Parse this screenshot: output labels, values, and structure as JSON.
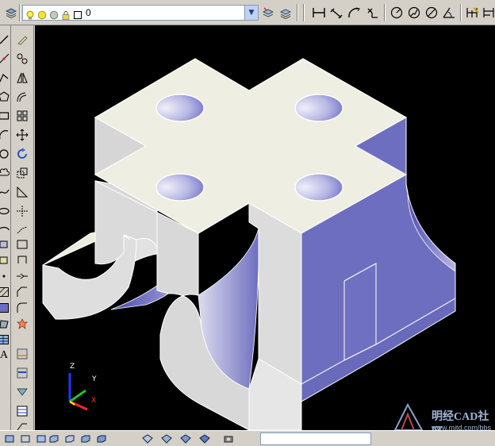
{
  "toolbar": {
    "layer_combo": {
      "current_layer": "0",
      "icons": [
        "layer-manager-icon",
        "bulb-on-icon",
        "sun-thaw-icon",
        "color-swatch-icon",
        "lock-icon",
        "square-color-icon"
      ]
    },
    "buttons": [
      "make-object-layer-current-icon",
      "layer-previous-icon",
      "linear-dimension-icon",
      "aligned-dimension-icon",
      "arc-length-icon",
      "ordinate-dimension-icon",
      "radius-dimension-icon",
      "jogged-dimension-icon",
      "diameter-dimension-icon",
      "angular-dimension-icon",
      "quick-dimension-icon",
      "baseline-dimension-icon"
    ]
  },
  "left_toolbar": {
    "draw_tools": [
      "line-icon",
      "construction-line-icon",
      "polyline-icon",
      "polygon-icon",
      "rectangle-icon",
      "arc-icon",
      "circle-icon",
      "revision-cloud-icon",
      "spline-icon",
      "ellipse-icon",
      "ellipse-arc-icon",
      "insert-block-icon",
      "make-block-icon",
      "point-icon",
      "hatch-icon",
      "gradient-icon",
      "region-icon",
      "table-icon",
      "multiline-text-icon"
    ],
    "modify_tools": [
      "erase-icon",
      "copy-icon",
      "mirror-icon",
      "offset-icon",
      "array-icon",
      "move-icon",
      "rotate-icon",
      "scale-icon",
      "stretch-icon",
      "trim-icon",
      "extend-icon",
      "break-at-point-icon",
      "break-icon",
      "join-icon",
      "chamfer-icon",
      "fillet-icon",
      "explode-icon"
    ],
    "extra_tools": [
      "dimension-style-icon",
      "dim-update-icon",
      "text-style-icon",
      "table-style-icon",
      "multileader-icon"
    ]
  },
  "viewport": {
    "ucs": {
      "z_label": "Z",
      "y_label": "Y",
      "x_label": "X"
    },
    "colors": {
      "background": "#000000",
      "top_face": "#eeeee2",
      "light_face": "#d9d9d9",
      "blue_face": "#6e6ec0",
      "hole_light": "#f0f0fa",
      "hole_dark": "#6c6cc6",
      "edge": "#ffffff"
    }
  },
  "bottom_toolbar": {
    "buttons": [
      "top-view-icon",
      "bottom-view-icon",
      "left-view-icon",
      "right-view-icon",
      "front-view-icon",
      "back-view-icon",
      "sw-iso-icon",
      "se-iso-icon",
      "ne-iso-icon",
      "nw-iso-icon",
      "camera-icon",
      "render-icon"
    ]
  },
  "watermark": {
    "title": "明经CAD社区",
    "url": "www.mjtd.com/bbs"
  }
}
